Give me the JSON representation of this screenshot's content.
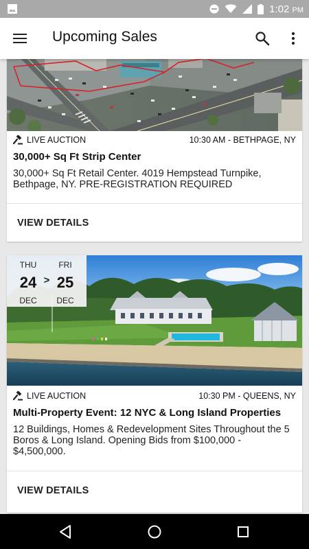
{
  "status_bar": {
    "time": "1:02",
    "ampm": "PM",
    "icons": [
      "gallery-icon",
      "do-not-disturb-icon",
      "wifi-icon",
      "signal-icon",
      "battery-icon"
    ]
  },
  "app_bar": {
    "title": "Upcoming Sales",
    "icons": [
      "menu-icon",
      "search-icon",
      "more-vert-icon"
    ]
  },
  "sales": [
    {
      "type_label": "LIVE AUCTION",
      "time_location": "10:30 AM - BETHPAGE, NY",
      "title": "30,000+ Sq Ft Strip Center",
      "description": "30,000+ Sq Ft Retail Center. 4019 Hempstead Turnpike, Bethpage, NY. PRE-REGISTRATION REQUIRED",
      "button_label": "VIEW DETAILS",
      "image_icon": "aerial-photo-image"
    },
    {
      "type_label": "LIVE AUCTION",
      "time_location": "10:30 PM - QUEENS, NY",
      "title": "Multi-Property Event: 12 NYC & Long Island Properties",
      "description": "12 Buildings, Homes & Redevelopment Sites Throughout the 5 Boros & Long Island. Opening Bids from $100,000 - $4,500,000.",
      "button_label": "VIEW DETAILS",
      "image_icon": "waterfront-estate-image",
      "dates": {
        "start": {
          "dow": "THU",
          "day": "24",
          "month": "DEC"
        },
        "arrow": ">",
        "end": {
          "dow": "FRI",
          "day": "25",
          "month": "DEC"
        }
      }
    }
  ],
  "nav_bar": {
    "icons": [
      "back-icon",
      "home-icon",
      "recents-icon"
    ]
  },
  "colors": {
    "status_bar": "#a9a9a9",
    "background": "#e8e8e8",
    "card": "#ffffff",
    "nav_bar": "#000000"
  }
}
